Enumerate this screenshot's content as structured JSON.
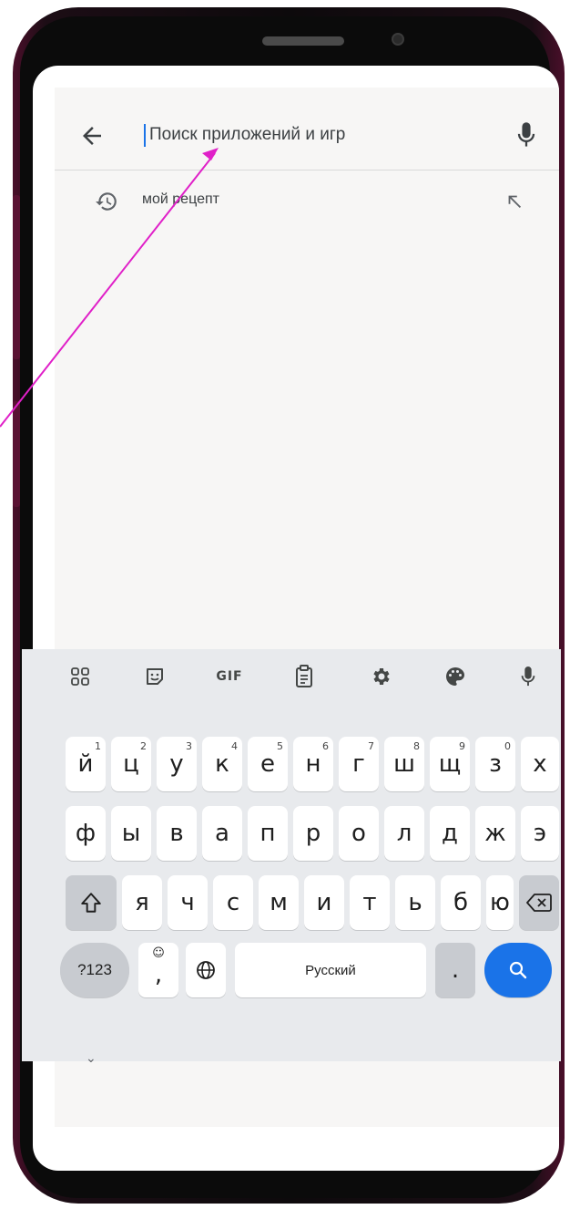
{
  "search": {
    "placeholder": "Поиск приложений и игр"
  },
  "history": [
    {
      "text": "мой рецепт"
    }
  ],
  "keyboard": {
    "toolbar_gif": "GIF",
    "row1": [
      {
        "key": "й",
        "hint": "1"
      },
      {
        "key": "ц",
        "hint": "2"
      },
      {
        "key": "у",
        "hint": "3"
      },
      {
        "key": "к",
        "hint": "4"
      },
      {
        "key": "е",
        "hint": "5"
      },
      {
        "key": "н",
        "hint": "6"
      },
      {
        "key": "г",
        "hint": "7"
      },
      {
        "key": "ш",
        "hint": "8"
      },
      {
        "key": "щ",
        "hint": "9"
      },
      {
        "key": "з",
        "hint": "0"
      },
      {
        "key": "х",
        "hint": ""
      }
    ],
    "row2": [
      "ф",
      "ы",
      "в",
      "а",
      "п",
      "р",
      "о",
      "л",
      "д",
      "ж",
      "э"
    ],
    "row3": [
      "я",
      "ч",
      "с",
      "м",
      "и",
      "т",
      "ь",
      "б",
      "ю"
    ],
    "num_label": "?123",
    "comma": ",",
    "space_label": "Русский",
    "period": "."
  },
  "colors": {
    "accent": "#1a73e8",
    "frame": "#4a0f2a",
    "annotation_arrow": "#e020c8"
  }
}
